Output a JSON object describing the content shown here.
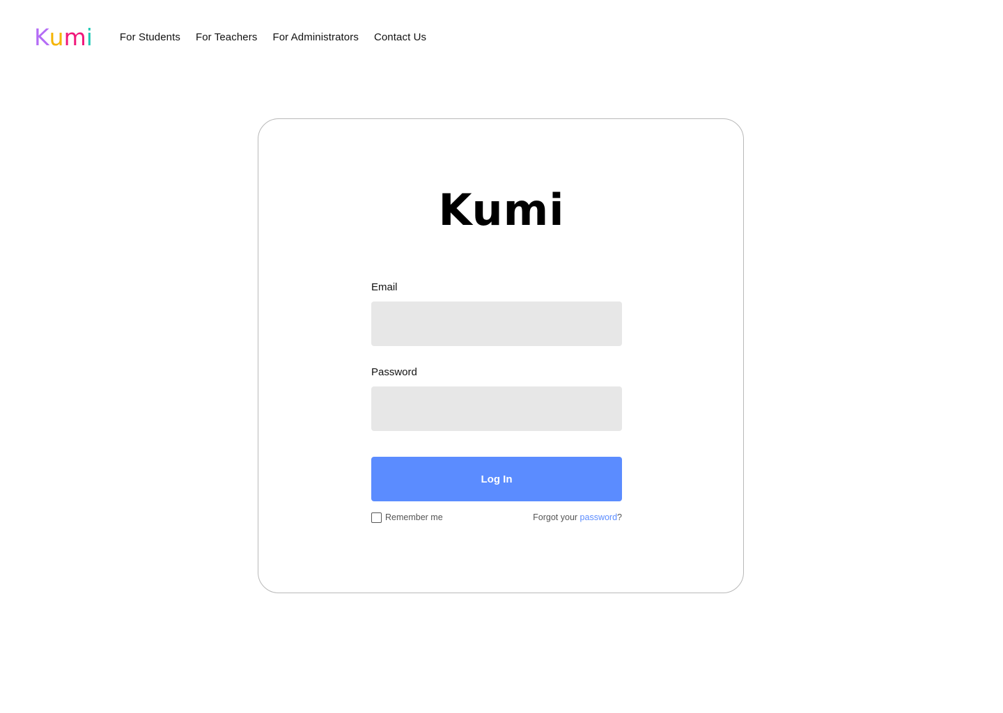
{
  "brand": {
    "letters": [
      {
        "char": "K",
        "color": "#b46cf5"
      },
      {
        "char": "u",
        "color": "#f5b400"
      },
      {
        "char": "m",
        "color": "#f0177a"
      },
      {
        "char": "i",
        "color": "#1ec9b4"
      }
    ]
  },
  "nav": {
    "items": [
      {
        "label": "For Students"
      },
      {
        "label": "For Teachers"
      },
      {
        "label": "For Administrators"
      },
      {
        "label": "Contact Us"
      }
    ]
  },
  "login": {
    "title": "Kumi",
    "email_label": "Email",
    "email_value": "",
    "password_label": "Password",
    "password_value": "",
    "submit_label": "Log In",
    "remember_label": "Remember me",
    "remember_checked": false,
    "forgot_prefix": "Forgot your ",
    "forgot_link": "password",
    "forgot_suffix": "?"
  },
  "colors": {
    "accent": "#5b8cff",
    "input_bg": "#e7e7e7",
    "card_border": "#b8b8b8"
  }
}
